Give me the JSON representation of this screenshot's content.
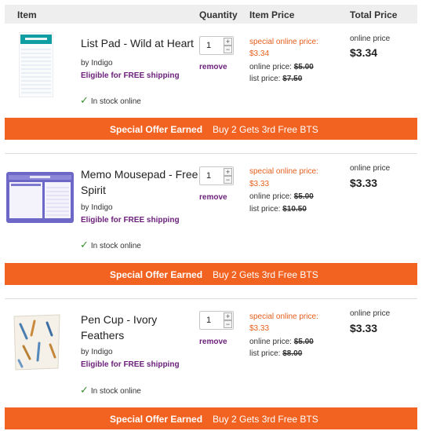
{
  "header": {
    "item": "Item",
    "quantity": "Quantity",
    "item_price": "Item Price",
    "total_price": "Total Price"
  },
  "products": [
    {
      "name": "List Pad - Wild at Heart",
      "by": "by Indigo",
      "shipping": "Eligible for FREE shipping",
      "stock": "In stock online",
      "qty": "1",
      "remove": "remove",
      "special_label": "special online price:",
      "special_price": "$3.34",
      "online_label": "online price:",
      "online_price": "$5.00",
      "list_label": "list price:",
      "list_price": "$7.50",
      "total_label": "online price",
      "total_price": "$3.34"
    },
    {
      "name": "Memo Mousepad - Free Spirit",
      "by": "by Indigo",
      "shipping": "Eligible for FREE shipping",
      "stock": "In stock online",
      "qty": "1",
      "remove": "remove",
      "special_label": "special online price:",
      "special_price": "$3.33",
      "online_label": "online price:",
      "online_price": "$5.00",
      "list_label": "list price:",
      "list_price": "$10.50",
      "total_label": "online price",
      "total_price": "$3.33"
    },
    {
      "name": "Pen Cup - Ivory Feathers",
      "by": "by Indigo",
      "shipping": "Eligible for FREE shipping",
      "stock": "In stock online",
      "qty": "1",
      "remove": "remove",
      "special_label": "special online price:",
      "special_price": "$3.33",
      "online_label": "online price:",
      "online_price": "$5.00",
      "list_label": "list price:",
      "list_price": "$8.00",
      "total_label": "online price",
      "total_price": "$3.33"
    }
  ],
  "offer": {
    "earned": "Special Offer Earned",
    "deal": "Buy 2 Gets 3rd Free BTS"
  },
  "colors": {
    "accent": "#f26322",
    "link": "#6b1f7a",
    "sale": "#e85d1a",
    "in_stock": "#3a8d2f"
  },
  "icons": [
    "checkmark-icon",
    "plus-icon",
    "minus-icon"
  ]
}
